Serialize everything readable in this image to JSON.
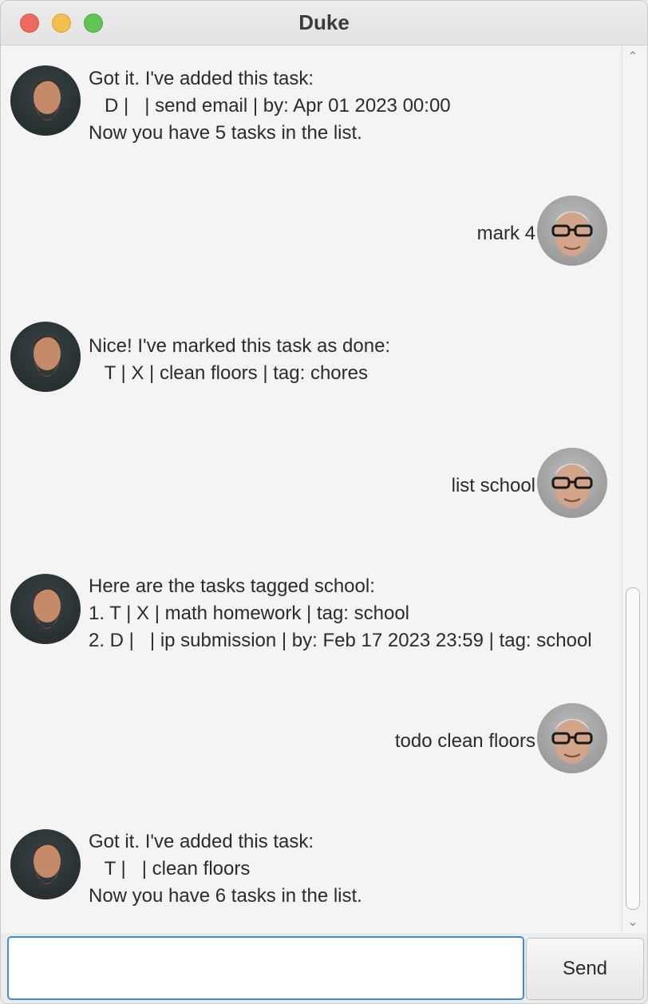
{
  "window": {
    "title": "Duke"
  },
  "colors": {
    "accent": "#3a90d6",
    "close": "#ed6a5e",
    "minimize": "#f5bf4f",
    "maximize": "#61c454"
  },
  "messages": [
    {
      "sender": "duke",
      "text": "Got it. I've added this task:\n   D |   | send email | by: Apr 01 2023 00:00\nNow you have 5 tasks in the list."
    },
    {
      "sender": "user",
      "text": "mark 4"
    },
    {
      "sender": "duke",
      "text": "Nice! I've marked this task as done:\n   T | X | clean floors | tag: chores"
    },
    {
      "sender": "user",
      "text": "list school"
    },
    {
      "sender": "duke",
      "text": "Here are the tasks tagged school:\n1. T | X | math homework | tag: school\n2. D |   | ip submission | by: Feb 17 2023 23:59 | tag: school"
    },
    {
      "sender": "user",
      "text": "todo clean floors"
    },
    {
      "sender": "duke",
      "text": "Got it. I've added this task:\n   T |   | clean floors\nNow you have 6 tasks in the list."
    }
  ],
  "input": {
    "value": "",
    "placeholder": ""
  },
  "send_button": {
    "label": "Send"
  },
  "icons": {
    "scroll_up": "▲-icon",
    "scroll_down": "▼-icon"
  }
}
